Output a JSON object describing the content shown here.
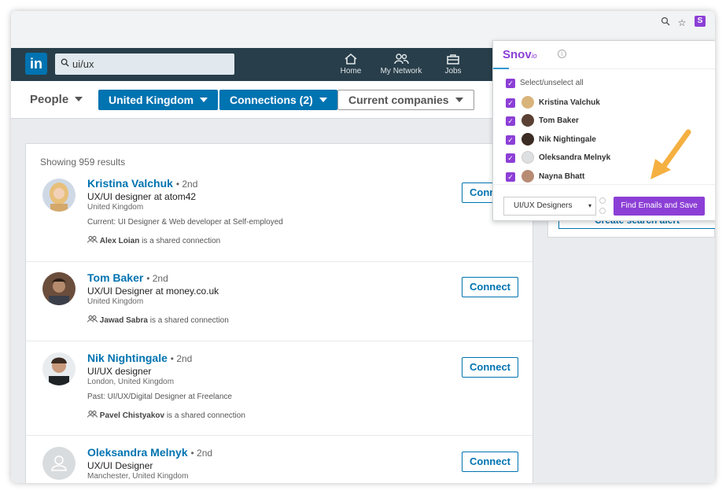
{
  "browser": {
    "icons": [
      "zoom-icon",
      "star-icon",
      "snovio-extension-icon"
    ],
    "extension_letter": "S"
  },
  "nav": {
    "search_value": "ui/ux",
    "items": [
      {
        "label": "Home",
        "icon": "home-icon"
      },
      {
        "label": "My Network",
        "icon": "network-icon"
      },
      {
        "label": "Jobs",
        "icon": "briefcase-icon"
      }
    ]
  },
  "filters": {
    "people_label": "People",
    "location": "United Kingdom",
    "connections": "Connections (2)",
    "companies": "Current companies"
  },
  "results": {
    "summary": "Showing 959 results",
    "connect_label": "Connect",
    "shared_suffix": "is a shared connection",
    "items": [
      {
        "name": "Kristina Valchuk",
        "degree": "• 2nd",
        "title": "UX/UI designer at atom42",
        "location": "United Kingdom",
        "extra": "Current: UI Designer & Web developer at Self-employed",
        "shared": "Alex Loian"
      },
      {
        "name": "Tom Baker",
        "degree": "• 2nd",
        "title": "UX/UI Designer at money.co.uk",
        "location": "United Kingdom",
        "extra": "",
        "shared": "Jawad Sabra"
      },
      {
        "name": "Nik Nightingale",
        "degree": "• 2nd",
        "title": "UI/UX designer",
        "location": "London, United Kingdom",
        "extra": "Past: UI/UX/Digital Designer at Freelance",
        "shared": "Pavel Chistyakov"
      },
      {
        "name": "Oleksandra Melnyk",
        "degree": "• 2nd",
        "title": "UX/UI Designer",
        "location": "Manchester, United Kingdom",
        "extra": "",
        "shared": ""
      }
    ]
  },
  "sidebar": {
    "alert_label": "Create search alert",
    "edge_letter": "w"
  },
  "snov": {
    "logo": "Snov",
    "logo_suffix": "io",
    "select_all_label": "Select/unselect all",
    "people": [
      "Kristina Valchuk",
      "Tom Baker",
      "Nik Nightingale",
      "Oleksandra Melnyk",
      "Nayna Bhatt"
    ],
    "list_value": "UI/UX Designers",
    "find_button": "Find Emails and Save",
    "accent_color": "#8c3fd6"
  },
  "colors": {
    "linkedin_blue": "#0073b1",
    "nav_bg": "#283e4a",
    "arrow": "#f5b041"
  }
}
